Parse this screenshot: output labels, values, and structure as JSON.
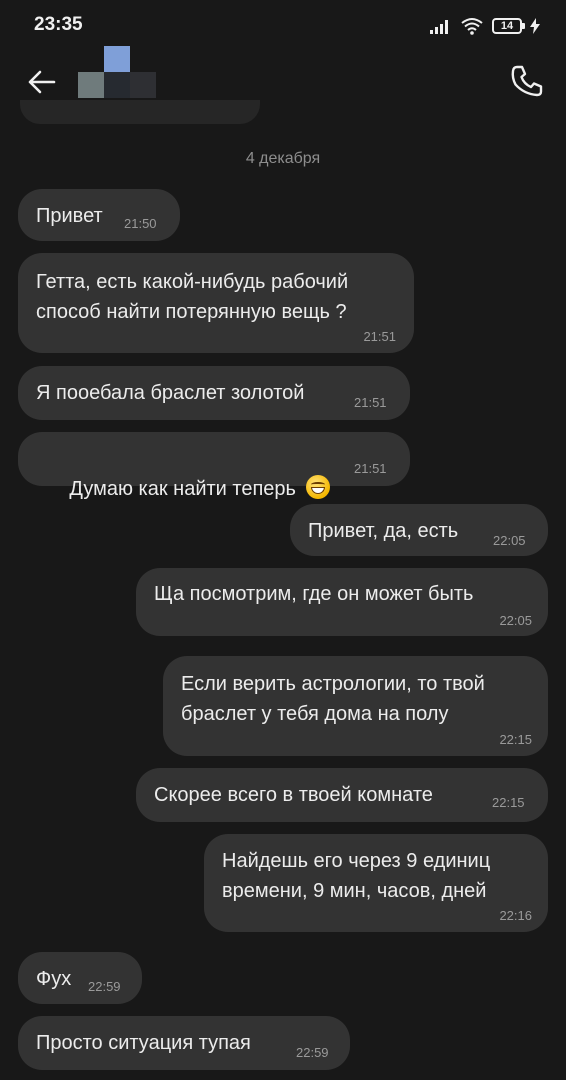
{
  "status_bar": {
    "time": "23:35",
    "battery": "14"
  },
  "contact": {
    "name_hidden": true
  },
  "date_separator": "4 декабря",
  "messages": [
    {
      "side": "in",
      "text": "Привет",
      "time": "21:50"
    },
    {
      "side": "in",
      "text": "Гетта, есть какой-нибудь рабочий\nспособ найти потерянную вещь ?",
      "time": "21:51"
    },
    {
      "side": "in",
      "text": "Я пооебала браслет золотой",
      "time": "21:51"
    },
    {
      "side": "in",
      "text": "Думаю как найти теперь",
      "emoji": "grinning-face",
      "time": "21:51"
    },
    {
      "side": "out",
      "text": "Привет, да, есть",
      "time": "22:05"
    },
    {
      "side": "out",
      "text": "Ща посмотрим, где он может быть",
      "time": "22:05"
    },
    {
      "side": "out",
      "text": "Если верить астрологии, то твой\nбраслет у тебя дома на полу",
      "time": "22:15"
    },
    {
      "side": "out",
      "text": "Скорее всего в твоей комнате",
      "time": "22:15"
    },
    {
      "side": "out",
      "text": "Найдешь его через 9 единиц\nвремени, 9 мин, часов, дней",
      "time": "22:16"
    },
    {
      "side": "in",
      "text": "Фух",
      "time": "22:59"
    },
    {
      "side": "in",
      "text": "Просто ситуация тупая",
      "time": "22:59"
    }
  ],
  "colors": {
    "background": "#181818",
    "bubble": "#333333",
    "text": "#ececec",
    "timestamp": "#9a9a9a"
  },
  "icons": {
    "back": "arrow-left-icon",
    "call": "phone-icon",
    "signal": "signal-icon",
    "wifi": "wifi-icon",
    "battery": "battery-icon",
    "charging": "bolt-icon"
  }
}
